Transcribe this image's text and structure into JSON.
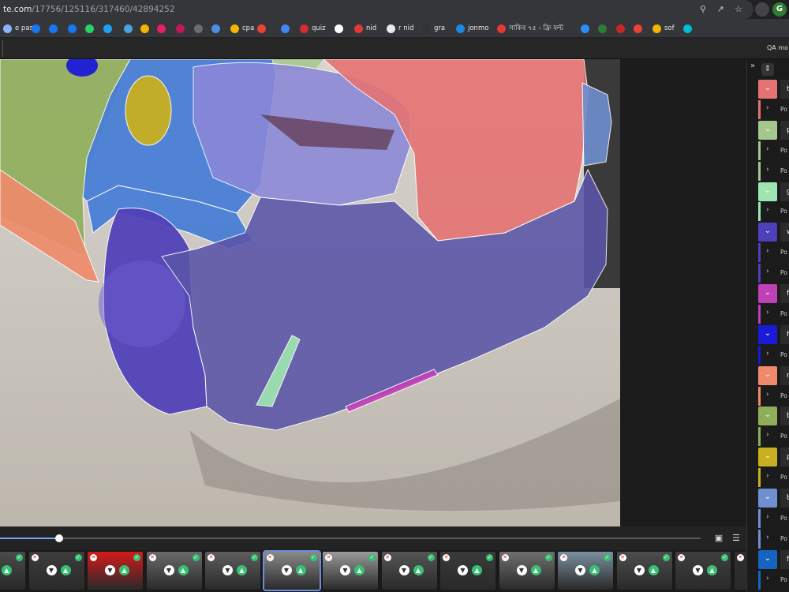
{
  "browser": {
    "url_host": "te.com",
    "url_path": "/17756/125116/317460/42894252"
  },
  "bookmarks": [
    {
      "label": "e pass",
      "color": "#8ab4f8"
    },
    {
      "label": "",
      "color": "#1877f2"
    },
    {
      "label": "",
      "color": "#1877f2"
    },
    {
      "label": "",
      "color": "#1877f2"
    },
    {
      "label": "",
      "color": "#25d366"
    },
    {
      "label": "",
      "color": "#1da1f2"
    },
    {
      "label": "",
      "color": "#4aa3df"
    },
    {
      "label": "",
      "color": "#f4b400"
    },
    {
      "label": "",
      "color": "#e91e63"
    },
    {
      "label": "",
      "color": "#c2185b"
    },
    {
      "label": "",
      "color": "#6d6d6d"
    },
    {
      "label": "",
      "color": "#4a90e2"
    },
    {
      "label": "cpa",
      "color": "#f4b400"
    },
    {
      "label": "",
      "color": "#ea4335"
    },
    {
      "label": "",
      "color": "#4285f4"
    },
    {
      "label": "quiz",
      "color": "#d32f2f"
    },
    {
      "label": "",
      "color": "#ffffff"
    },
    {
      "label": "nid",
      "color": "#e53935"
    },
    {
      "label": "r nid",
      "color": "#e8eaed"
    },
    {
      "label": "gra",
      "color": "#333333"
    },
    {
      "label": "jonmo",
      "color": "#1e88e5"
    },
    {
      "label": "সাকিব ৭৫ - ফ্রি ফন্ট",
      "color": "#e53935"
    },
    {
      "label": "",
      "color": "#2d8cff"
    },
    {
      "label": "",
      "color": "#2e7d32"
    },
    {
      "label": "",
      "color": "#c62828"
    },
    {
      "label": "",
      "color": "#ea4335"
    },
    {
      "label": "sof",
      "color": "#f4b400"
    },
    {
      "label": "",
      "color": "#00bcd4"
    }
  ],
  "toolbar": {
    "qa_label": "QA mo"
  },
  "right_panel": {
    "collapse_glyph": "»",
    "entries": [
      {
        "kind": "label",
        "letter": "t",
        "color": "#e57373"
      },
      {
        "kind": "polygon",
        "text": "Po",
        "color": "#e57373"
      },
      {
        "kind": "label",
        "letter": "p",
        "color": "#a5c78d"
      },
      {
        "kind": "polygon",
        "text": "Po",
        "color": "#a5c78d"
      },
      {
        "kind": "polygon",
        "text": "Po",
        "color": "#a5c78d"
      },
      {
        "kind": "label",
        "letter": "g",
        "color": "#9ee6b0"
      },
      {
        "kind": "polygon",
        "text": "Po",
        "color": "#9ee6b0"
      },
      {
        "kind": "label",
        "letter": "w",
        "color": "#4f3fb8"
      },
      {
        "kind": "polygon",
        "text": "Po",
        "color": "#4f3fb8"
      },
      {
        "kind": "polygon",
        "text": "Po",
        "color": "#4f3fb8"
      },
      {
        "kind": "label",
        "letter": "f",
        "color": "#c040b8"
      },
      {
        "kind": "polygon",
        "text": "Po",
        "color": "#c040b8"
      },
      {
        "kind": "label",
        "letter": "h",
        "color": "#1a1ad8"
      },
      {
        "kind": "polygon",
        "text": "Po",
        "color": "#1a1ad8"
      },
      {
        "kind": "label",
        "letter": "r",
        "color": "#f08a6a"
      },
      {
        "kind": "polygon",
        "text": "Po",
        "color": "#f08a6a"
      },
      {
        "kind": "label",
        "letter": "b",
        "color": "#8fae5a"
      },
      {
        "kind": "polygon",
        "text": "Po",
        "color": "#8fae5a"
      },
      {
        "kind": "label",
        "letter": "p",
        "color": "#c8b020"
      },
      {
        "kind": "polygon",
        "text": "Po",
        "color": "#c8b020"
      },
      {
        "kind": "label",
        "letter": "b",
        "color": "#6f8fd0"
      },
      {
        "kind": "polygon",
        "text": "Po",
        "color": "#6f8fd0"
      },
      {
        "kind": "polygon",
        "text": "Po",
        "color": "#6f8fd0"
      },
      {
        "kind": "label",
        "letter": "f",
        "color": "#1565c0"
      },
      {
        "kind": "polygon",
        "text": "Po",
        "color": "#1565c0"
      }
    ]
  },
  "timeline": {
    "progress": 0.085
  },
  "thumbnails": [
    {
      "bg": "#4a4a4a",
      "selected": false
    },
    {
      "bg": "#3d3d3d",
      "selected": false
    },
    {
      "bg": "#d41a1a",
      "selected": false
    },
    {
      "bg": "#6b6b6b",
      "selected": false
    },
    {
      "bg": "#5e5e5e",
      "selected": false
    },
    {
      "bg": "#8a8a8a",
      "selected": true
    },
    {
      "bg": "#9a9a9a",
      "selected": false
    },
    {
      "bg": "#555555",
      "selected": false
    },
    {
      "bg": "#3a3a3a",
      "selected": false
    },
    {
      "bg": "#6f6f6f",
      "selected": false
    },
    {
      "bg": "#7a8fa0",
      "selected": false
    },
    {
      "bg": "#4d4d4d",
      "selected": false
    },
    {
      "bg": "#3f3f3f",
      "selected": false
    },
    {
      "bg": "#2e2e2e",
      "selected": false
    }
  ]
}
